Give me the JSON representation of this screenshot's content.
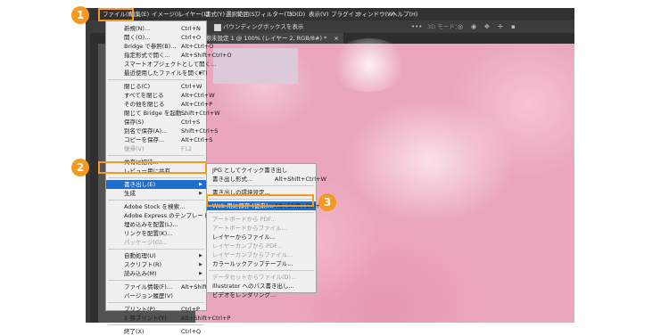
{
  "menubar": {
    "items": [
      "ファイル(F)",
      "編集(E)",
      "イメージ(I)",
      "レイヤー(L)",
      "書式(Y)",
      "選択範囲(S)",
      "フィルター(T)",
      "3D(D)",
      "表示(V)",
      "プラグイン",
      "ウィンドウ(W)",
      "ヘルプ(H)"
    ]
  },
  "options_bar": {
    "checkbox_label": "バウンディングボックスを表示",
    "mode_3d": "3D モード："
  },
  "document_tab": {
    "title": "名称未設定 1 @ 100% (レイヤー 2, RGB/8#) *",
    "close": "×"
  },
  "file_menu": {
    "items": [
      {
        "label": "新規(N)...",
        "shortcut": "Ctrl+N"
      },
      {
        "label": "開く(O)...",
        "shortcut": "Ctrl+O"
      },
      {
        "label": "Bridge で参照(B)...",
        "shortcut": "Alt+Ctrl+O"
      },
      {
        "label": "指定形式で開く...",
        "shortcut": "Alt+Shift+Ctrl+O"
      },
      {
        "label": "スマートオブジェクトとして開く...",
        "shortcut": ""
      },
      {
        "label": "最近使用したファイルを開く(T)",
        "shortcut": "",
        "submenu": true
      },
      {
        "sep": true
      },
      {
        "label": "閉じる(C)",
        "shortcut": "Ctrl+W"
      },
      {
        "label": "すべてを閉じる",
        "shortcut": "Alt+Ctrl+W"
      },
      {
        "label": "その他を閉じる",
        "shortcut": "Alt+Ctrl+P"
      },
      {
        "label": "閉じて Bridge を起動...",
        "shortcut": "Shift+Ctrl+W"
      },
      {
        "label": "保存(S)",
        "shortcut": "Ctrl+S"
      },
      {
        "label": "別名で保存(A)...",
        "shortcut": "Shift+Ctrl+S"
      },
      {
        "label": "コピーを保存...",
        "shortcut": "Alt+Ctrl+S"
      },
      {
        "label": "復帰(V)",
        "shortcut": "F12",
        "disabled": true
      },
      {
        "sep": true
      },
      {
        "label": "共有に招待...",
        "shortcut": ""
      },
      {
        "label": "レビュー用に共有...",
        "shortcut": ""
      },
      {
        "sep": true
      },
      {
        "label": "書き出し(E)",
        "shortcut": "",
        "submenu": true,
        "highlighted": true
      },
      {
        "label": "生成",
        "shortcut": "",
        "submenu": true
      },
      {
        "sep": true
      },
      {
        "label": "Adobe Stock を検索...",
        "shortcut": ""
      },
      {
        "label": "Adobe Express のテンプレートの検索...",
        "shortcut": ""
      },
      {
        "label": "埋め込みを配置(L)...",
        "shortcut": ""
      },
      {
        "label": "リンクを配置(K)...",
        "shortcut": ""
      },
      {
        "label": "パッケージ(G)...",
        "shortcut": "",
        "disabled": true
      },
      {
        "sep": true
      },
      {
        "label": "自動処理(U)",
        "shortcut": "",
        "submenu": true
      },
      {
        "label": "スクリプト(R)",
        "shortcut": "",
        "submenu": true
      },
      {
        "label": "読み込み(M)",
        "shortcut": "",
        "submenu": true
      },
      {
        "sep": true
      },
      {
        "label": "ファイル情報(F)...",
        "shortcut": "Alt+Shift+Ctrl+I"
      },
      {
        "label": "バージョン履歴(V)",
        "shortcut": ""
      },
      {
        "sep": true
      },
      {
        "label": "プリント(P)...",
        "shortcut": "Ctrl+P"
      },
      {
        "label": "1 部プリント(Y)",
        "shortcut": "Alt+Shift+Ctrl+P"
      },
      {
        "sep": true
      },
      {
        "label": "終了(X)",
        "shortcut": "Ctrl+Q"
      }
    ]
  },
  "export_submenu": {
    "items": [
      {
        "label": "JPG としてクイック書き出し",
        "shortcut": ""
      },
      {
        "label": "書き出し形式...",
        "shortcut": "Alt+Shift+Ctrl+W"
      },
      {
        "sep": true
      },
      {
        "label": "書き出しの環境設定...",
        "shortcut": ""
      },
      {
        "sep": true
      },
      {
        "label": "Web 用に保存 (従来)...",
        "shortcut": "Alt+Shift+Ctrl+S",
        "highlighted": true
      },
      {
        "sep": true
      },
      {
        "label": "アートボードから PDF...",
        "shortcut": "",
        "disabled": true
      },
      {
        "label": "アートボードからファイル...",
        "shortcut": "",
        "disabled": true
      },
      {
        "label": "レイヤーからファイル...",
        "shortcut": ""
      },
      {
        "label": "レイヤーカンプから PDF...",
        "shortcut": "",
        "disabled": true
      },
      {
        "label": "レイヤーカンプからファイル...",
        "shortcut": "",
        "disabled": true
      },
      {
        "label": "カラールックアップテーブル...",
        "shortcut": ""
      },
      {
        "sep": true
      },
      {
        "label": "データセットからファイル(D)...",
        "shortcut": "",
        "disabled": true
      },
      {
        "label": "Illustrator へのパス書き出し...",
        "shortcut": ""
      },
      {
        "label": "ビデオをレンダリング...",
        "shortcut": ""
      }
    ]
  },
  "badges": [
    "1",
    "2",
    "3"
  ],
  "colors": {
    "accent": "#f49a22",
    "highlight": "#1e6ecd"
  }
}
